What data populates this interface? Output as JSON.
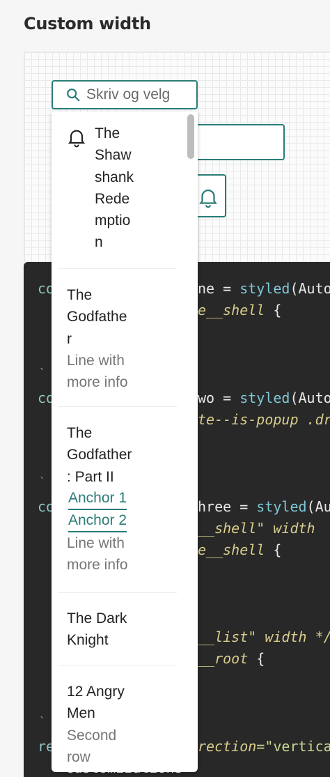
{
  "page": {
    "title": "Custom width"
  },
  "search": {
    "placeholder": "Skriv og velg"
  },
  "options": [
    {
      "title_lines": [
        "The",
        "Shaw",
        "shank",
        "Rede",
        "mptio",
        "n"
      ]
    },
    {
      "title_lines": [
        "The",
        "Godfathe",
        "r"
      ],
      "sub_lines": [
        "Line with",
        "more info"
      ]
    },
    {
      "title_lines": [
        "The",
        "Godfather",
        ": Part II"
      ],
      "anchors": [
        "Anchor 1",
        "Anchor 2"
      ],
      "sub_lines": [
        "Line with",
        "more info"
      ]
    },
    {
      "title_lines": [
        "The Dark",
        "Knight"
      ]
    },
    {
      "title_lines": [
        "12 Angry",
        "Men"
      ],
      "sub_lines": [
        "Second",
        "row"
      ]
    }
  ],
  "code": {
    "line1": {
      "kw": "co",
      "rest": "ne = ",
      "fn": "styled",
      "tail": "(Auto"
    },
    "line2": {
      "it": "e__shell",
      "tail": " {"
    },
    "line3": {
      "kw": "co",
      "rest": "wo = ",
      "fn": "styled",
      "tail": "(Auto"
    },
    "line4": {
      "it": "te--is-popup .dr"
    },
    "line5": {
      "kw": "co",
      "rest": "hree = ",
      "fn": "styled",
      "tail": "(Au"
    },
    "line6": {
      "it": "__shell\" width "
    },
    "line7": {
      "it": "e__shell",
      "tail": " {"
    },
    "line8": {
      "it": "__list\" width */"
    },
    "line9": {
      "it": "__root",
      "tail": " {"
    },
    "line10": {
      "kw": "re",
      "it": "rection",
      "tail": "=\"vertica"
    },
    "line11": {
      "text": "customizations"
    },
    "tick": "`"
  },
  "colors": {
    "accent": "#2a7c78",
    "code_bg": "#282828"
  },
  "icons": {
    "option1": "bell-icon",
    "search": "search-icon",
    "ghost_button": "bell-icon"
  }
}
